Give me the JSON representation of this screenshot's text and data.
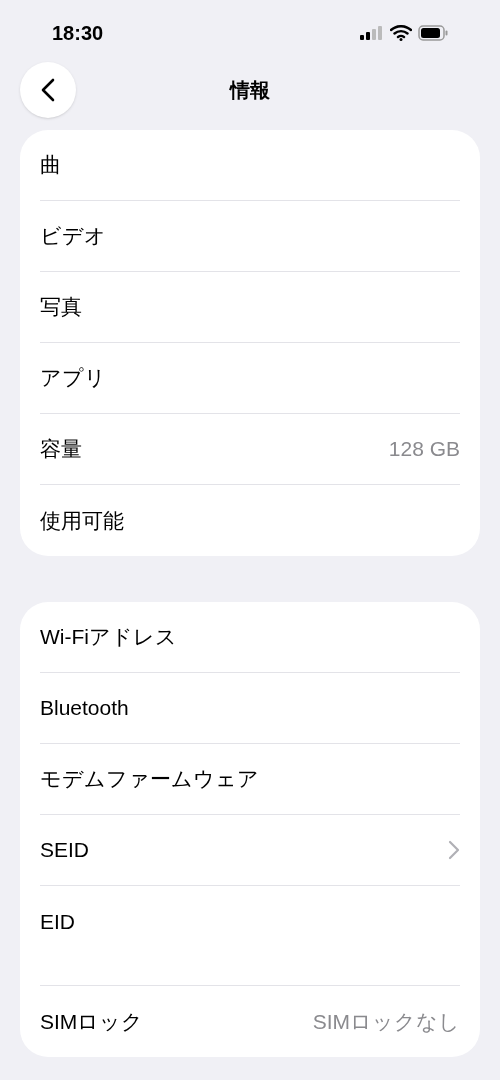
{
  "status_bar": {
    "time": "18:30"
  },
  "nav": {
    "title": "情報"
  },
  "groups": [
    {
      "rows": [
        {
          "label": "曲",
          "chevron": false,
          "tall": false
        },
        {
          "label": "ビデオ",
          "chevron": false,
          "tall": false
        },
        {
          "label": "写真",
          "chevron": false,
          "tall": false
        },
        {
          "label": "アプリ",
          "chevron": false,
          "tall": false
        },
        {
          "label": "容量",
          "value": "128 GB",
          "chevron": false,
          "tall": false
        },
        {
          "label": "使用可能",
          "chevron": false,
          "tall": false
        }
      ]
    },
    {
      "rows": [
        {
          "label": "Wi-Fiアドレス",
          "chevron": false,
          "tall": false
        },
        {
          "label": "Bluetooth",
          "chevron": false,
          "tall": false
        },
        {
          "label": "モデムファームウェア",
          "chevron": false,
          "tall": false
        },
        {
          "label": "SEID",
          "chevron": true,
          "tall": false
        },
        {
          "label": "EID",
          "chevron": false,
          "tall": true
        },
        {
          "label": "SIMロック",
          "value": "SIMロックなし",
          "chevron": false,
          "tall": false
        }
      ]
    }
  ]
}
